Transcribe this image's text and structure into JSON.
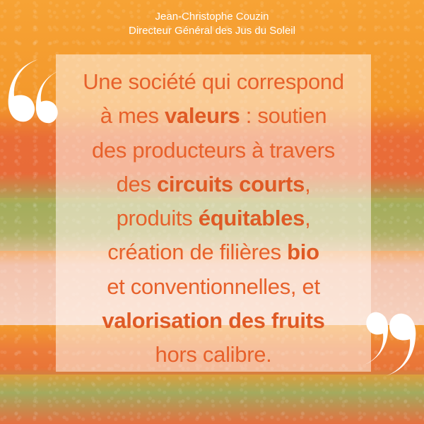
{
  "author": {
    "name": "Jean-Christophe Couzin",
    "role": "Directeur Général des Jus du Soleil"
  },
  "quote": {
    "l1": "Une société qui correspond",
    "l2_a": "à mes ",
    "l2_b": "valeurs",
    "l2_c": " : soutien",
    "l3": "des producteurs à travers",
    "l4_a": "des ",
    "l4_b": "circuits courts",
    "l4_c": ",",
    "l5_a": "produits ",
    "l5_b": "équitables",
    "l5_c": ",",
    "l6_a": "création de filières ",
    "l6_b": "bio",
    "l7": "et conventionnelles, et",
    "l8": "valorisation des fruits",
    "l9": "hors calibre."
  },
  "icons": {
    "open": "opening-quote-icon",
    "close": "closing-quote-icon"
  },
  "colors": {
    "quote_text": "#e7612b",
    "author_text": "#ffffff",
    "orange": "#f39a2e",
    "red_orange": "#e96d37",
    "green": "#a4ad5c",
    "pink": "#f3c3ad"
  }
}
